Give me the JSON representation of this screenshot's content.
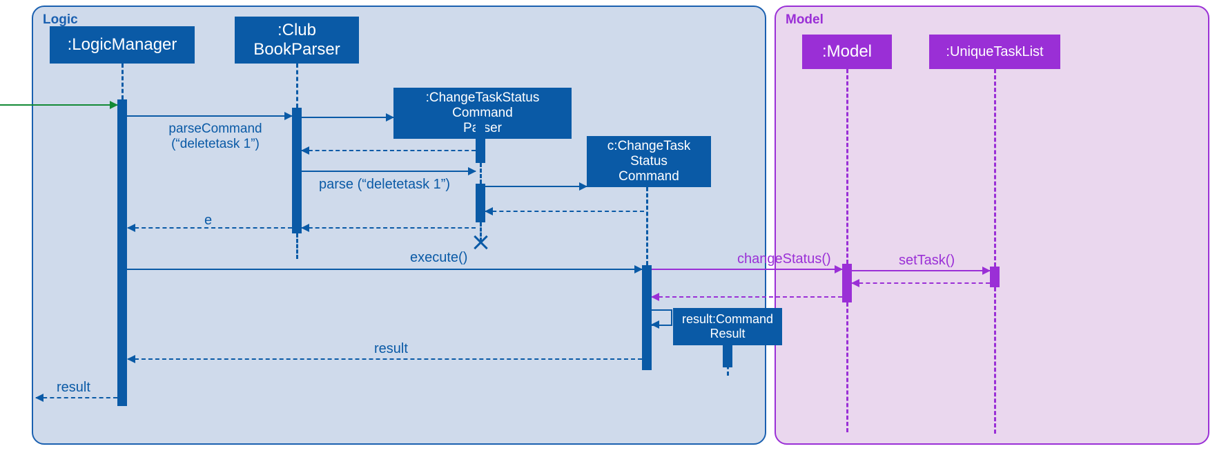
{
  "frames": {
    "logic": {
      "label": "Logic"
    },
    "model": {
      "label": "Model"
    }
  },
  "participants": {
    "logicManager": {
      "label": ":LogicManager"
    },
    "clubBookParser": {
      "label": ":Club\nBookParser"
    },
    "changeTaskStatusParser": {
      "label": ":ChangeTaskStatus\nCommand\nParser"
    },
    "changeTaskStatusCommand": {
      "label": "c:ChangeTask\nStatus\nCommand"
    },
    "commandResult": {
      "label": "result:Command\nResult"
    },
    "modelObj": {
      "label": ":Model"
    },
    "uniqueTaskList": {
      "label": ":UniqueTaskList"
    }
  },
  "messages": {
    "parseCommand": {
      "label": "parseCommand",
      "arg": "(“deletetask 1”)"
    },
    "parse": {
      "label": "parse (“deletetask 1”)"
    },
    "e": {
      "label": "e"
    },
    "execute": {
      "label": "execute()"
    },
    "changeStatus": {
      "label": "changeStatus()"
    },
    "setTask": {
      "label": "setTask()"
    },
    "resultReturn": {
      "label": "result"
    },
    "finalResult": {
      "label": "result"
    }
  },
  "colors": {
    "logic": "#0a5aa6",
    "model": "#9a2fd6",
    "entry": "#138a36"
  }
}
